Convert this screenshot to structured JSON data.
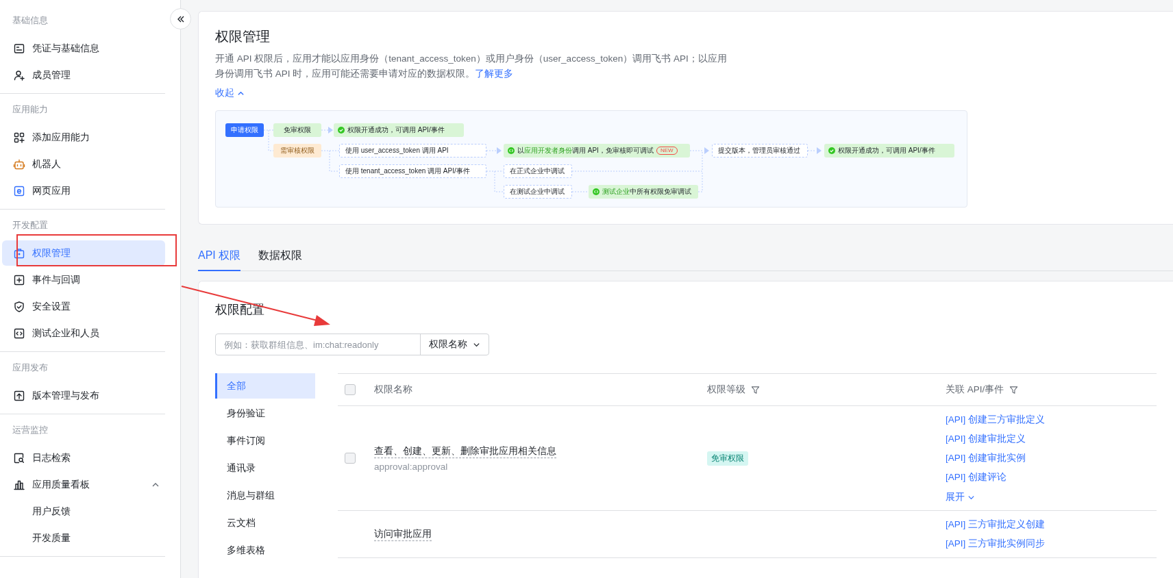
{
  "sidebar": {
    "sections": [
      {
        "title": "基础信息",
        "items": [
          {
            "label": "凭证与基础信息",
            "selected": false
          },
          {
            "label": "成员管理",
            "selected": false
          }
        ]
      },
      {
        "title": "应用能力",
        "items": [
          {
            "label": "添加应用能力",
            "selected": false
          },
          {
            "label": "机器人",
            "selected": false
          },
          {
            "label": "网页应用",
            "selected": false
          }
        ]
      },
      {
        "title": "开发配置",
        "items": [
          {
            "label": "权限管理",
            "selected": true
          },
          {
            "label": "事件与回调",
            "selected": false
          },
          {
            "label": "安全设置",
            "selected": false
          },
          {
            "label": "测试企业和人员",
            "selected": false
          }
        ]
      },
      {
        "title": "应用发布",
        "items": [
          {
            "label": "版本管理与发布",
            "selected": false
          }
        ]
      },
      {
        "title": "运营监控",
        "items": [
          {
            "label": "日志检索",
            "selected": false
          },
          {
            "label": "应用质量看板",
            "selected": false,
            "expanded": true,
            "children": [
              {
                "label": "用户反馈",
                "selected": false
              },
              {
                "label": "开发质量",
                "selected": false
              }
            ]
          }
        ]
      }
    ]
  },
  "intro": {
    "title": "权限管理",
    "description": "开通 API 权限后，应用才能以应用身份（tenant_access_token）或用户身份（user_access_token）调用飞书 API；以应用身份调用飞书 API 时，应用可能还需要申请对应的数据权限。",
    "learn_more": "了解更多",
    "collapse": "收起",
    "expanded": true,
    "flow": [
      {
        "kind": "start",
        "parts": [
          {
            "text": "申请权限"
          }
        ]
      },
      {
        "kind": "free",
        "parts": [
          {
            "text": "免审权限"
          }
        ]
      },
      {
        "kind": "success",
        "parts": [
          {
            "text": "权限开通成功，可调用 API/事件"
          }
        ]
      },
      {
        "kind": "review",
        "parts": [
          {
            "text": "需审核权限"
          }
        ]
      },
      {
        "kind": "step",
        "parts": [
          {
            "text": "使用 user_access_token 调用 API"
          }
        ]
      },
      {
        "kind": "tip",
        "parts": [
          {
            "text": "以"
          },
          {
            "text": "应用开发者身份",
            "accent": true
          },
          {
            "text": "调用 API，免审核即可调试"
          }
        ],
        "badge": "NEW"
      },
      {
        "kind": "step",
        "parts": [
          {
            "text": "提交版本，管理员审核通过"
          }
        ]
      },
      {
        "kind": "success",
        "parts": [
          {
            "text": "权限开通成功，可调用 API/事件"
          }
        ]
      },
      {
        "kind": "step",
        "parts": [
          {
            "text": "使用 tenant_access_token 调用 API/事件"
          }
        ]
      },
      {
        "kind": "step",
        "parts": [
          {
            "text": "在正式企业中调试"
          }
        ]
      },
      {
        "kind": "step",
        "parts": [
          {
            "text": "在测试企业中调试"
          }
        ]
      },
      {
        "kind": "tip",
        "parts": [
          {
            "text": "测试企业",
            "accent": true
          },
          {
            "text": "中所有权限免审调试"
          }
        ]
      }
    ]
  },
  "tabs": [
    {
      "label": "API 权限",
      "selected": true
    },
    {
      "label": "数据权限",
      "selected": false
    }
  ],
  "config": {
    "title": "权限配置",
    "search": {
      "placeholder": "例如：获取群组信息、im:chat:readonly"
    },
    "search_scope": "权限名称",
    "categories": [
      {
        "label": "全部",
        "selected": true
      },
      {
        "label": "身份验证",
        "selected": false
      },
      {
        "label": "事件订阅",
        "selected": false
      },
      {
        "label": "通讯录",
        "selected": false
      },
      {
        "label": "消息与群组",
        "selected": false
      },
      {
        "label": "云文档",
        "selected": false
      },
      {
        "label": "多维表格",
        "selected": false
      }
    ],
    "table": {
      "select_all_checked": false,
      "columns": [
        {
          "label": "权限名称",
          "filter": false
        },
        {
          "label": "权限等级",
          "filter": true
        },
        {
          "label": "关联 API/事件",
          "filter": true
        }
      ],
      "rows": [
        {
          "checked": false,
          "name": "查看、创建、更新、删除审批应用相关信息",
          "scope": "approval:approval",
          "level": "免审权限",
          "apis": [
            "[API] 创建三方审批定义",
            "[API] 创建审批定义",
            "[API] 创建审批实例",
            "[API] 创建评论"
          ],
          "more": "展开"
        },
        {
          "name": "访问审批应用",
          "apis": [
            "[API] 三方审批定义创建",
            "[API] 三方审批实例同步"
          ]
        }
      ]
    }
  },
  "annotations": [
    {
      "kind": "box",
      "color": "#e83a3a"
    },
    {
      "kind": "arrow",
      "color": "#e83a3a"
    }
  ]
}
